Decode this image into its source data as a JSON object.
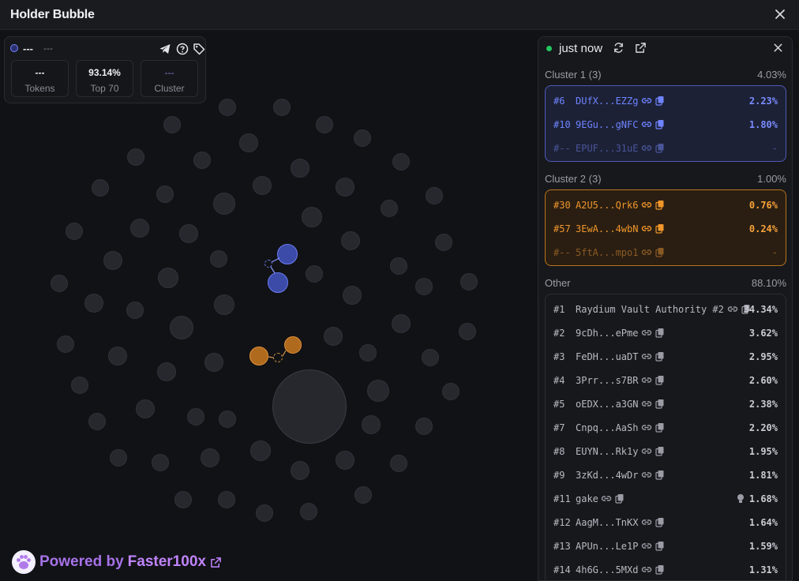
{
  "window": {
    "title": "Holder Bubble"
  },
  "stats": {
    "name": "---",
    "symbol": "---",
    "boxes": [
      {
        "value": "---",
        "label": "Tokens"
      },
      {
        "value": "93.14%",
        "label": "Top 70"
      },
      {
        "value": "---",
        "label": "Cluster"
      }
    ]
  },
  "footer": {
    "powered_by": "Powered by",
    "brand": "Faster100x"
  },
  "panel": {
    "updated": "just now",
    "clusters": [
      {
        "title": "Cluster 1 (3)",
        "pct": "4.03%",
        "rows": [
          {
            "rank": "#6",
            "addr": "DUfX...EZZg",
            "pct": "2.23%"
          },
          {
            "rank": "#10",
            "addr": "9EGu...gNFC",
            "pct": "1.80%"
          },
          {
            "rank": "#--",
            "addr": "EPUF...31uE",
            "pct": "-"
          }
        ]
      },
      {
        "title": "Cluster 2 (3)",
        "pct": "1.00%",
        "rows": [
          {
            "rank": "#30",
            "addr": "A2U5...Qrk6",
            "pct": "0.76%"
          },
          {
            "rank": "#57",
            "addr": "3EwA...4wbN",
            "pct": "0.24%"
          },
          {
            "rank": "#--",
            "addr": "5ftA...mpo1",
            "pct": "-"
          }
        ]
      }
    ],
    "other": {
      "title": "Other",
      "pct": "88.10%",
      "rows": [
        {
          "rank": "#1",
          "addr": "Raydium Vault Authority #2",
          "pct": "34.34%"
        },
        {
          "rank": "#2",
          "addr": "9cDh...ePme",
          "pct": "3.62%"
        },
        {
          "rank": "#3",
          "addr": "FeDH...uaDT",
          "pct": "2.95%"
        },
        {
          "rank": "#4",
          "addr": "3Prr...s7BR",
          "pct": "2.60%"
        },
        {
          "rank": "#5",
          "addr": "oEDX...a3GN",
          "pct": "2.38%"
        },
        {
          "rank": "#7",
          "addr": "Cnpq...AaSh",
          "pct": "2.20%"
        },
        {
          "rank": "#8",
          "addr": "EUYN...Rk1y",
          "pct": "1.95%"
        },
        {
          "rank": "#9",
          "addr": "3zKd...4wDr",
          "pct": "1.81%"
        },
        {
          "rank": "#11",
          "addr": "gake",
          "pct": "1.68%"
        },
        {
          "rank": "#12",
          "addr": "AagM...TnKX",
          "pct": "1.64%"
        },
        {
          "rank": "#13",
          "addr": "APUn...Le1P",
          "pct": "1.59%"
        },
        {
          "rank": "#14",
          "addr": "4h6G...5MXd",
          "pct": "1.31%"
        }
      ]
    }
  },
  "colors": {
    "cluster1": "#6f84ff",
    "cluster2": "#f0962a",
    "live": "#22c55e",
    "brand": "#c084fc"
  }
}
